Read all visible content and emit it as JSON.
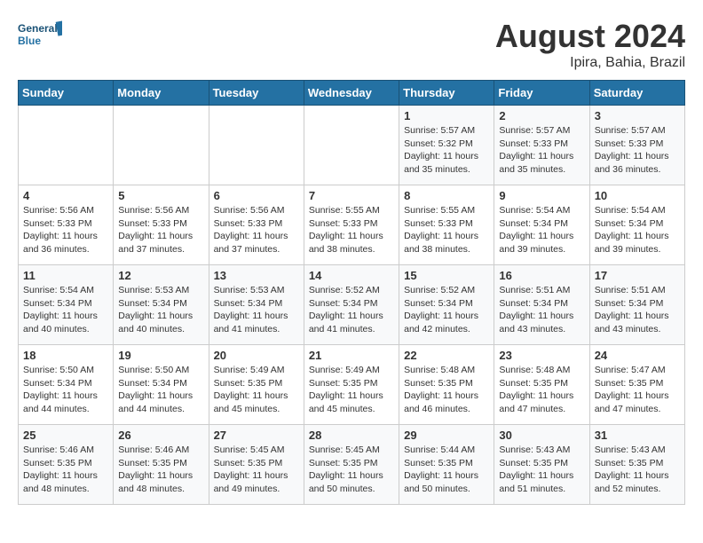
{
  "logo": {
    "text_general": "General",
    "text_blue": "Blue"
  },
  "calendar": {
    "title": "August 2024",
    "subtitle": "Ipira, Bahia, Brazil"
  },
  "weekdays": [
    "Sunday",
    "Monday",
    "Tuesday",
    "Wednesday",
    "Thursday",
    "Friday",
    "Saturday"
  ],
  "weeks": [
    [
      {
        "day": "",
        "info": ""
      },
      {
        "day": "",
        "info": ""
      },
      {
        "day": "",
        "info": ""
      },
      {
        "day": "",
        "info": ""
      },
      {
        "day": "1",
        "info": "Sunrise: 5:57 AM\nSunset: 5:32 PM\nDaylight: 11 hours and 35 minutes."
      },
      {
        "day": "2",
        "info": "Sunrise: 5:57 AM\nSunset: 5:33 PM\nDaylight: 11 hours and 35 minutes."
      },
      {
        "day": "3",
        "info": "Sunrise: 5:57 AM\nSunset: 5:33 PM\nDaylight: 11 hours and 36 minutes."
      }
    ],
    [
      {
        "day": "4",
        "info": "Sunrise: 5:56 AM\nSunset: 5:33 PM\nDaylight: 11 hours and 36 minutes."
      },
      {
        "day": "5",
        "info": "Sunrise: 5:56 AM\nSunset: 5:33 PM\nDaylight: 11 hours and 37 minutes."
      },
      {
        "day": "6",
        "info": "Sunrise: 5:56 AM\nSunset: 5:33 PM\nDaylight: 11 hours and 37 minutes."
      },
      {
        "day": "7",
        "info": "Sunrise: 5:55 AM\nSunset: 5:33 PM\nDaylight: 11 hours and 38 minutes."
      },
      {
        "day": "8",
        "info": "Sunrise: 5:55 AM\nSunset: 5:33 PM\nDaylight: 11 hours and 38 minutes."
      },
      {
        "day": "9",
        "info": "Sunrise: 5:54 AM\nSunset: 5:34 PM\nDaylight: 11 hours and 39 minutes."
      },
      {
        "day": "10",
        "info": "Sunrise: 5:54 AM\nSunset: 5:34 PM\nDaylight: 11 hours and 39 minutes."
      }
    ],
    [
      {
        "day": "11",
        "info": "Sunrise: 5:54 AM\nSunset: 5:34 PM\nDaylight: 11 hours and 40 minutes."
      },
      {
        "day": "12",
        "info": "Sunrise: 5:53 AM\nSunset: 5:34 PM\nDaylight: 11 hours and 40 minutes."
      },
      {
        "day": "13",
        "info": "Sunrise: 5:53 AM\nSunset: 5:34 PM\nDaylight: 11 hours and 41 minutes."
      },
      {
        "day": "14",
        "info": "Sunrise: 5:52 AM\nSunset: 5:34 PM\nDaylight: 11 hours and 41 minutes."
      },
      {
        "day": "15",
        "info": "Sunrise: 5:52 AM\nSunset: 5:34 PM\nDaylight: 11 hours and 42 minutes."
      },
      {
        "day": "16",
        "info": "Sunrise: 5:51 AM\nSunset: 5:34 PM\nDaylight: 11 hours and 43 minutes."
      },
      {
        "day": "17",
        "info": "Sunrise: 5:51 AM\nSunset: 5:34 PM\nDaylight: 11 hours and 43 minutes."
      }
    ],
    [
      {
        "day": "18",
        "info": "Sunrise: 5:50 AM\nSunset: 5:34 PM\nDaylight: 11 hours and 44 minutes."
      },
      {
        "day": "19",
        "info": "Sunrise: 5:50 AM\nSunset: 5:34 PM\nDaylight: 11 hours and 44 minutes."
      },
      {
        "day": "20",
        "info": "Sunrise: 5:49 AM\nSunset: 5:35 PM\nDaylight: 11 hours and 45 minutes."
      },
      {
        "day": "21",
        "info": "Sunrise: 5:49 AM\nSunset: 5:35 PM\nDaylight: 11 hours and 45 minutes."
      },
      {
        "day": "22",
        "info": "Sunrise: 5:48 AM\nSunset: 5:35 PM\nDaylight: 11 hours and 46 minutes."
      },
      {
        "day": "23",
        "info": "Sunrise: 5:48 AM\nSunset: 5:35 PM\nDaylight: 11 hours and 47 minutes."
      },
      {
        "day": "24",
        "info": "Sunrise: 5:47 AM\nSunset: 5:35 PM\nDaylight: 11 hours and 47 minutes."
      }
    ],
    [
      {
        "day": "25",
        "info": "Sunrise: 5:46 AM\nSunset: 5:35 PM\nDaylight: 11 hours and 48 minutes."
      },
      {
        "day": "26",
        "info": "Sunrise: 5:46 AM\nSunset: 5:35 PM\nDaylight: 11 hours and 48 minutes."
      },
      {
        "day": "27",
        "info": "Sunrise: 5:45 AM\nSunset: 5:35 PM\nDaylight: 11 hours and 49 minutes."
      },
      {
        "day": "28",
        "info": "Sunrise: 5:45 AM\nSunset: 5:35 PM\nDaylight: 11 hours and 50 minutes."
      },
      {
        "day": "29",
        "info": "Sunrise: 5:44 AM\nSunset: 5:35 PM\nDaylight: 11 hours and 50 minutes."
      },
      {
        "day": "30",
        "info": "Sunrise: 5:43 AM\nSunset: 5:35 PM\nDaylight: 11 hours and 51 minutes."
      },
      {
        "day": "31",
        "info": "Sunrise: 5:43 AM\nSunset: 5:35 PM\nDaylight: 11 hours and 52 minutes."
      }
    ]
  ]
}
